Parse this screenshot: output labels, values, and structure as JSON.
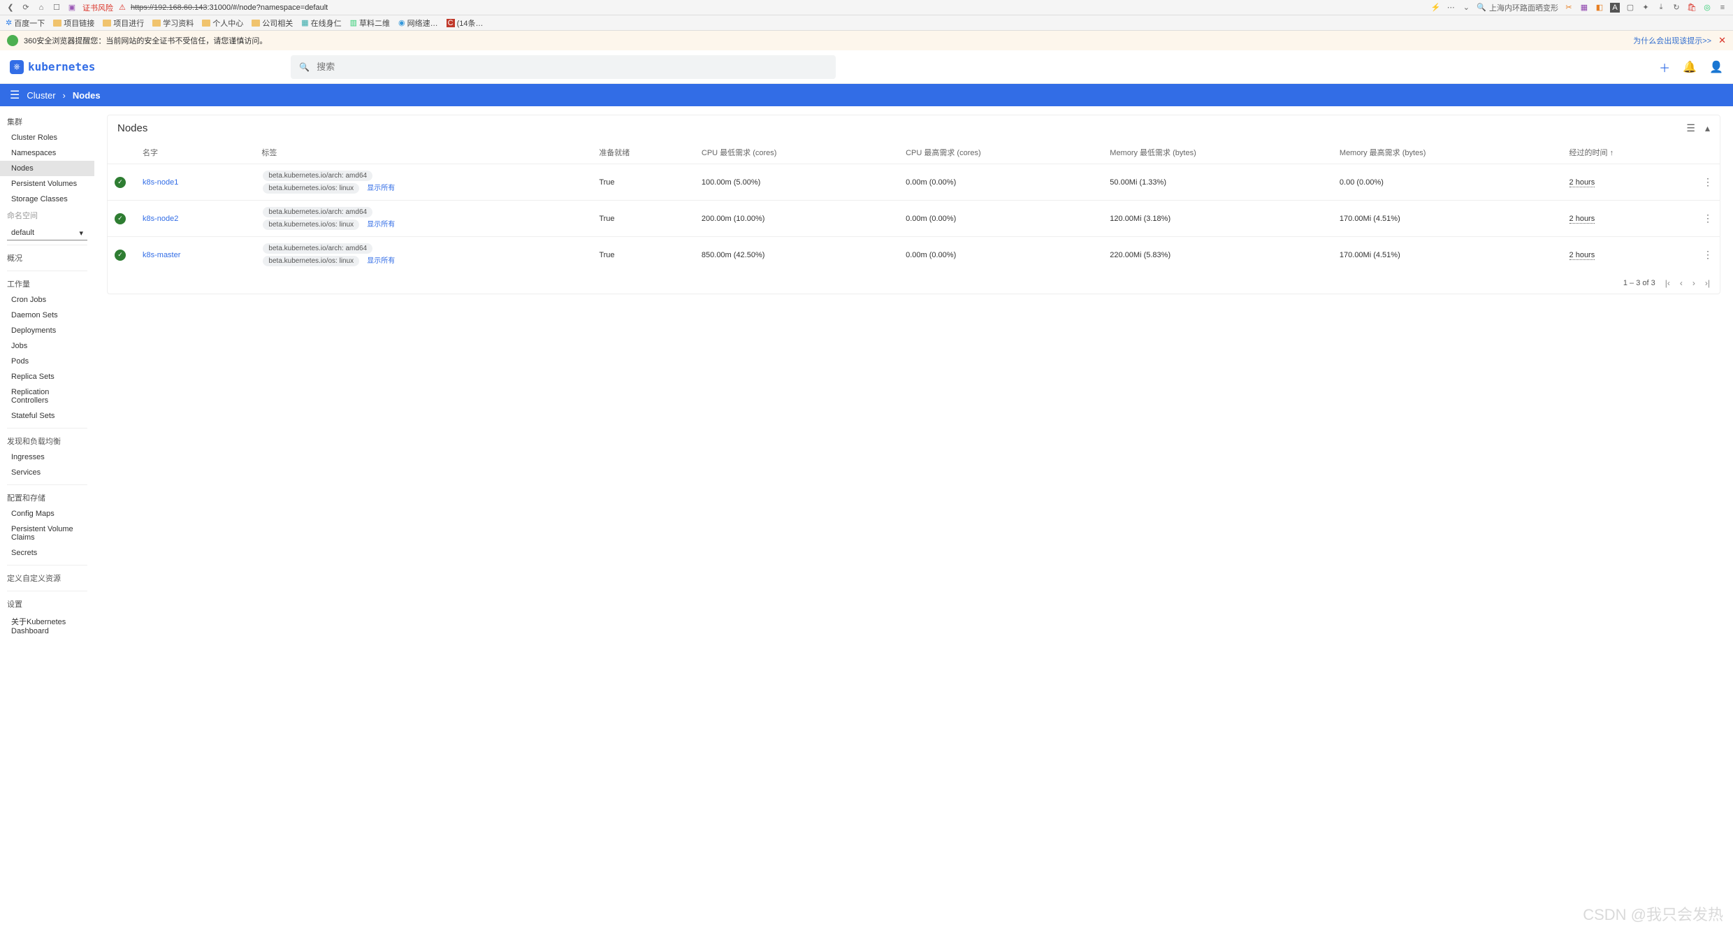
{
  "browser": {
    "cert_warning": "证书风险",
    "url_protocol": "https://",
    "url_host": "192.168.60.143",
    "url_port_path": ":31000/#/node?namespace=default",
    "search_text": "上海内环路面晒变形",
    "why_prompt": "为什么会出现该提示>>",
    "bookmarks": [
      "百度一下",
      "项目链接",
      "项目进行",
      "学习资料",
      "个人中心",
      "公司相关",
      "在线身仁",
      "草料二维",
      "网络速…",
      "(14条…"
    ],
    "security_warning": "360安全浏览器提醒您：当前网站的安全证书不受信任，请您谨慎访问。"
  },
  "header": {
    "logo_text": "kubernetes",
    "search_placeholder": "搜索"
  },
  "breadcrumb": {
    "root": "Cluster",
    "current": "Nodes"
  },
  "sidebar": {
    "group_cluster": "集群",
    "cluster_items": [
      "Cluster Roles",
      "Namespaces",
      "Nodes",
      "Persistent Volumes",
      "Storage Classes"
    ],
    "group_namespace": "命名空间",
    "namespace_selected": "default",
    "group_overview": "概况",
    "group_workloads": "工作量",
    "workloads_items": [
      "Cron Jobs",
      "Daemon Sets",
      "Deployments",
      "Jobs",
      "Pods",
      "Replica Sets",
      "Replication Controllers",
      "Stateful Sets"
    ],
    "group_discovery": "发现和负载均衡",
    "discovery_items": [
      "Ingresses",
      "Services"
    ],
    "group_config": "配置和存储",
    "config_items": [
      "Config Maps",
      "Persistent Volume Claims",
      "Secrets"
    ],
    "group_crd": "定义自定义资源",
    "group_settings": "设置",
    "about": "关于Kubernetes Dashboard"
  },
  "nodes": {
    "title": "Nodes",
    "columns": {
      "name": "名字",
      "labels": "标签",
      "ready": "准备就绪",
      "cpu_req": "CPU 最低需求 (cores)",
      "cpu_lim": "CPU 最高需求 (cores)",
      "mem_req": "Memory 最低需求 (bytes)",
      "mem_lim": "Memory 最高需求 (bytes)",
      "age": "经过的时间"
    },
    "show_all": "显示所有",
    "rows": [
      {
        "name": "k8s-node1",
        "labels": [
          "beta.kubernetes.io/arch: amd64",
          "beta.kubernetes.io/os: linux"
        ],
        "ready": "True",
        "cpu_req": "100.00m (5.00%)",
        "cpu_lim": "0.00m (0.00%)",
        "mem_req": "50.00Mi (1.33%)",
        "mem_lim": "0.00 (0.00%)",
        "age": "2 hours"
      },
      {
        "name": "k8s-node2",
        "labels": [
          "beta.kubernetes.io/arch: amd64",
          "beta.kubernetes.io/os: linux"
        ],
        "ready": "True",
        "cpu_req": "200.00m (10.00%)",
        "cpu_lim": "0.00m (0.00%)",
        "mem_req": "120.00Mi (3.18%)",
        "mem_lim": "170.00Mi (4.51%)",
        "age": "2 hours"
      },
      {
        "name": "k8s-master",
        "labels": [
          "beta.kubernetes.io/arch: amd64",
          "beta.kubernetes.io/os: linux"
        ],
        "ready": "True",
        "cpu_req": "850.00m (42.50%)",
        "cpu_lim": "0.00m (0.00%)",
        "mem_req": "220.00Mi (5.83%)",
        "mem_lim": "170.00Mi (4.51%)",
        "age": "2 hours"
      }
    ],
    "pagination": "1 – 3 of 3"
  },
  "watermark": "CSDN @我只会发热"
}
